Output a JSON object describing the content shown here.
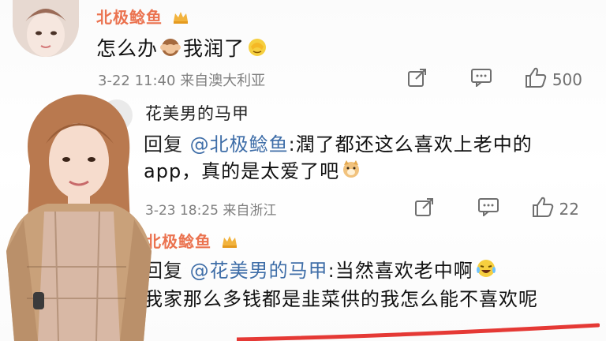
{
  "comments": [
    {
      "author": "北极鲶鱼",
      "text_before": "怎么办",
      "text_middle": "我润了",
      "time": "3-22 11:40",
      "source": "来自澳大利亚",
      "likes": "500"
    },
    {
      "author": "花美男的马甲",
      "reply_prefix": "回复",
      "mention": "@北极鲶鱼",
      "separator": ":",
      "reply_text": "潤了都还这么喜欢上老中的app，真的是太爱了吧",
      "time": "3-23 18:25",
      "source": "来自浙江",
      "likes": "22"
    },
    {
      "author": "北极鲶鱼",
      "reply_prefix": "回复",
      "mention": "@花美男的马甲",
      "separator": ":",
      "reply_text_a": "当然喜欢老中啊",
      "reply_text_b": "我家那么多钱都是韭菜供的我怎么能不喜欢呢"
    }
  ],
  "colors": {
    "author_accent": "#eb7350",
    "mention": "#3f6ea8",
    "meta": "#7f7f7f",
    "highlight_line": "#e53935"
  },
  "icons": [
    "crown-badge-icon",
    "monkey-see-no-evil-icon",
    "facepalm-emoji-icon",
    "share-icon",
    "comment-icon",
    "like-icon",
    "doge-emoji-icon",
    "laugh-cry-emoji-icon"
  ]
}
